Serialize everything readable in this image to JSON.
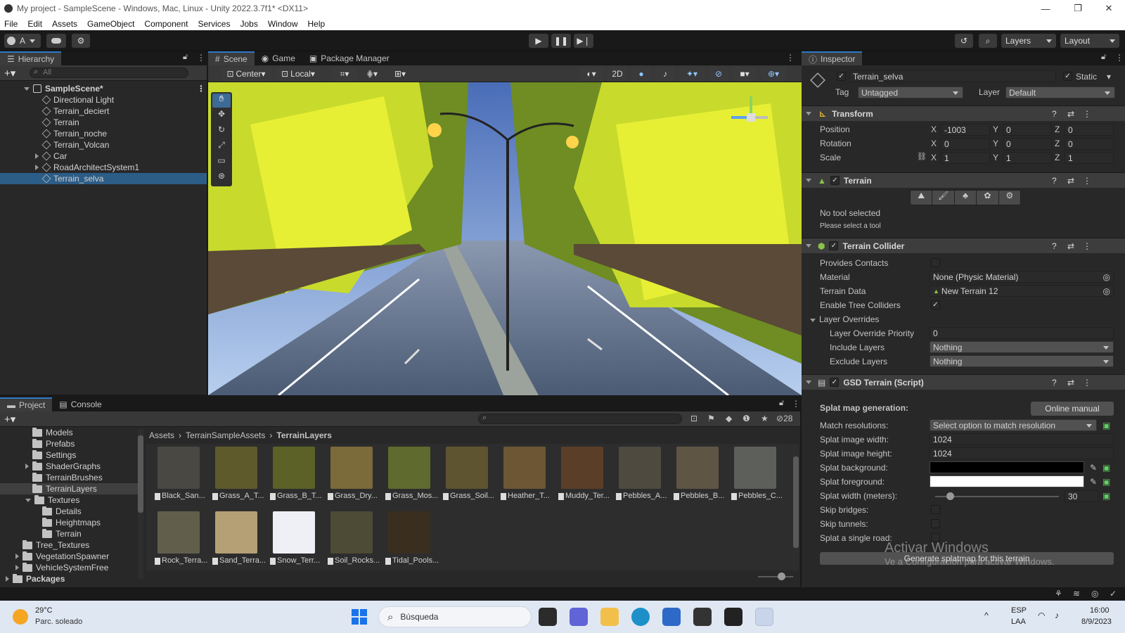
{
  "window": {
    "title": "My project - SampleScene - Windows, Mac, Linux - Unity 2022.3.7f1* <DX11>",
    "minimize": "—",
    "maximize": "❐",
    "close": "✕"
  },
  "menu": [
    "File",
    "Edit",
    "Assets",
    "GameObject",
    "Component",
    "Services",
    "Jobs",
    "Window",
    "Help"
  ],
  "toolbar": {
    "account": "A",
    "layers": "Layers",
    "layout": "Layout"
  },
  "hierarchy": {
    "tab": "Hierarchy",
    "search_placeholder": "All",
    "scene": "SampleScene*",
    "items": [
      {
        "label": "Directional Light",
        "expandable": false
      },
      {
        "label": "Terrain_deciert",
        "expandable": false
      },
      {
        "label": "Terrain",
        "expandable": false
      },
      {
        "label": "Terrain_noche",
        "expandable": false
      },
      {
        "label": "Terrain_Volcan",
        "expandable": false
      },
      {
        "label": "Car",
        "expandable": true
      },
      {
        "label": "RoadArchitectSystem1",
        "expandable": true
      },
      {
        "label": "Terrain_selva",
        "expandable": false
      }
    ],
    "selected": "Terrain_selva"
  },
  "scene_tabs": [
    "Scene",
    "Game",
    "Package Manager"
  ],
  "scene_toolbar": {
    "pivot": "Center",
    "space": "Local",
    "mode2d": "2D"
  },
  "inspector": {
    "tab": "Inspector",
    "object_name": "Terrain_selva",
    "static_label": "Static",
    "tag_label": "Tag",
    "tag_value": "Untagged",
    "layer_label": "Layer",
    "layer_value": "Default",
    "transform": {
      "title": "Transform",
      "position_label": "Position",
      "rotation_label": "Rotation",
      "scale_label": "Scale",
      "position": [
        "-1003",
        "0",
        "0"
      ],
      "rotation": [
        "0",
        "0",
        "0"
      ],
      "scale": [
        "1",
        "1",
        "1"
      ],
      "axes": [
        "X",
        "Y",
        "Z"
      ]
    },
    "terrain": {
      "title": "Terrain",
      "no_tool": "No tool selected",
      "hint": "Please select a tool"
    },
    "collider": {
      "title": "Terrain Collider",
      "provides_contacts": "Provides Contacts",
      "material_label": "Material",
      "material_value": "None (Physic Material)",
      "terrain_data_label": "Terrain Data",
      "terrain_data_value": "New Terrain 12",
      "enable_tree": "Enable Tree Colliders",
      "layer_overrides": "Layer Overrides",
      "priority_label": "Layer Override Priority",
      "priority_value": "0",
      "include_label": "Include Layers",
      "include_value": "Nothing",
      "exclude_label": "Exclude Layers",
      "exclude_value": "Nothing"
    },
    "gsd": {
      "title": "GSD Terrain (Script)",
      "splat_gen": "Splat map generation:",
      "manual": "Online manual",
      "match_label": "Match resolutions:",
      "match_value": "Select option to match resolution",
      "width_label": "Splat image width:",
      "width_value": "1024",
      "height_label": "Splat image height:",
      "height_value": "1024",
      "bg_label": "Splat background:",
      "fg_label": "Splat foreground:",
      "meters_label": "Splat width (meters):",
      "meters_value": "30",
      "meters_fraction": 0.12,
      "bridges": "Skip bridges:",
      "tunnels": "Skip tunnels:",
      "single_road": "Splat a single road:",
      "generate": "Generate splatmap for this terrain"
    }
  },
  "project": {
    "tabs": [
      "Project",
      "Console"
    ],
    "count": "28",
    "tree": [
      {
        "label": "Models",
        "indent": 2,
        "arrow": "none"
      },
      {
        "label": "Prefabs",
        "indent": 2,
        "arrow": "none"
      },
      {
        "label": "Settings",
        "indent": 2,
        "arrow": "none"
      },
      {
        "label": "ShaderGraphs",
        "indent": 2,
        "arrow": "right"
      },
      {
        "label": "TerrainBrushes",
        "indent": 2,
        "arrow": "none"
      },
      {
        "label": "TerrainLayers",
        "indent": 2,
        "arrow": "none",
        "selected": true
      },
      {
        "label": "Textures",
        "indent": 2,
        "arrow": "down"
      },
      {
        "label": "Details",
        "indent": 3,
        "arrow": "none"
      },
      {
        "label": "Heightmaps",
        "indent": 3,
        "arrow": "none"
      },
      {
        "label": "Terrain",
        "indent": 3,
        "arrow": "none"
      },
      {
        "label": "Tree_Textures",
        "indent": 1,
        "arrow": "none"
      },
      {
        "label": "VegetationSpawner",
        "indent": 1,
        "arrow": "right"
      },
      {
        "label": "VehicleSystemFree",
        "indent": 1,
        "arrow": "right"
      },
      {
        "label": "Packages",
        "indent": 0,
        "arrow": "right",
        "bold": true
      }
    ],
    "breadcrumb": [
      "Assets",
      "TerrainSampleAssets",
      "TerrainLayers"
    ],
    "assets": [
      {
        "label": "Black_San...",
        "color": "#4a4843"
      },
      {
        "label": "Grass_A_T...",
        "color": "#5f5a2c"
      },
      {
        "label": "Grass_B_T...",
        "color": "#5b6127"
      },
      {
        "label": "Grass_Dry...",
        "color": "#7b6a3a"
      },
      {
        "label": "Grass_Mos...",
        "color": "#5f6a2e"
      },
      {
        "label": "Grass_Soil...",
        "color": "#5e5430"
      },
      {
        "label": "Heather_T...",
        "color": "#6c5634"
      },
      {
        "label": "Muddy_Ter...",
        "color": "#5a3e28"
      },
      {
        "label": "Pebbles_A...",
        "color": "#4e4a3f"
      },
      {
        "label": "Pebbles_B...",
        "color": "#5f5545"
      },
      {
        "label": "Pebbles_C...",
        "color": "#5d5f5a"
      },
      {
        "label": "Rock_Terra...",
        "color": "#615f4c"
      },
      {
        "label": "Sand_Terra...",
        "color": "#b59f74"
      },
      {
        "label": "Snow_Terr...",
        "color": "#eef0f5"
      },
      {
        "label": "Soil_Rocks...",
        "color": "#4d4a36"
      },
      {
        "label": "Tidal_Pools...",
        "color": "#3a2e1f"
      }
    ]
  },
  "watermark": {
    "line1": "Activar Windows",
    "line2": "Ve a Configuración para activar Windows."
  },
  "taskbar": {
    "temp": "29°C",
    "weather": "Parc. soleado",
    "search": "Búsqueda",
    "lang1": "ESP",
    "lang2": "LAA",
    "time": "16:00",
    "date": "8/9/2023"
  }
}
